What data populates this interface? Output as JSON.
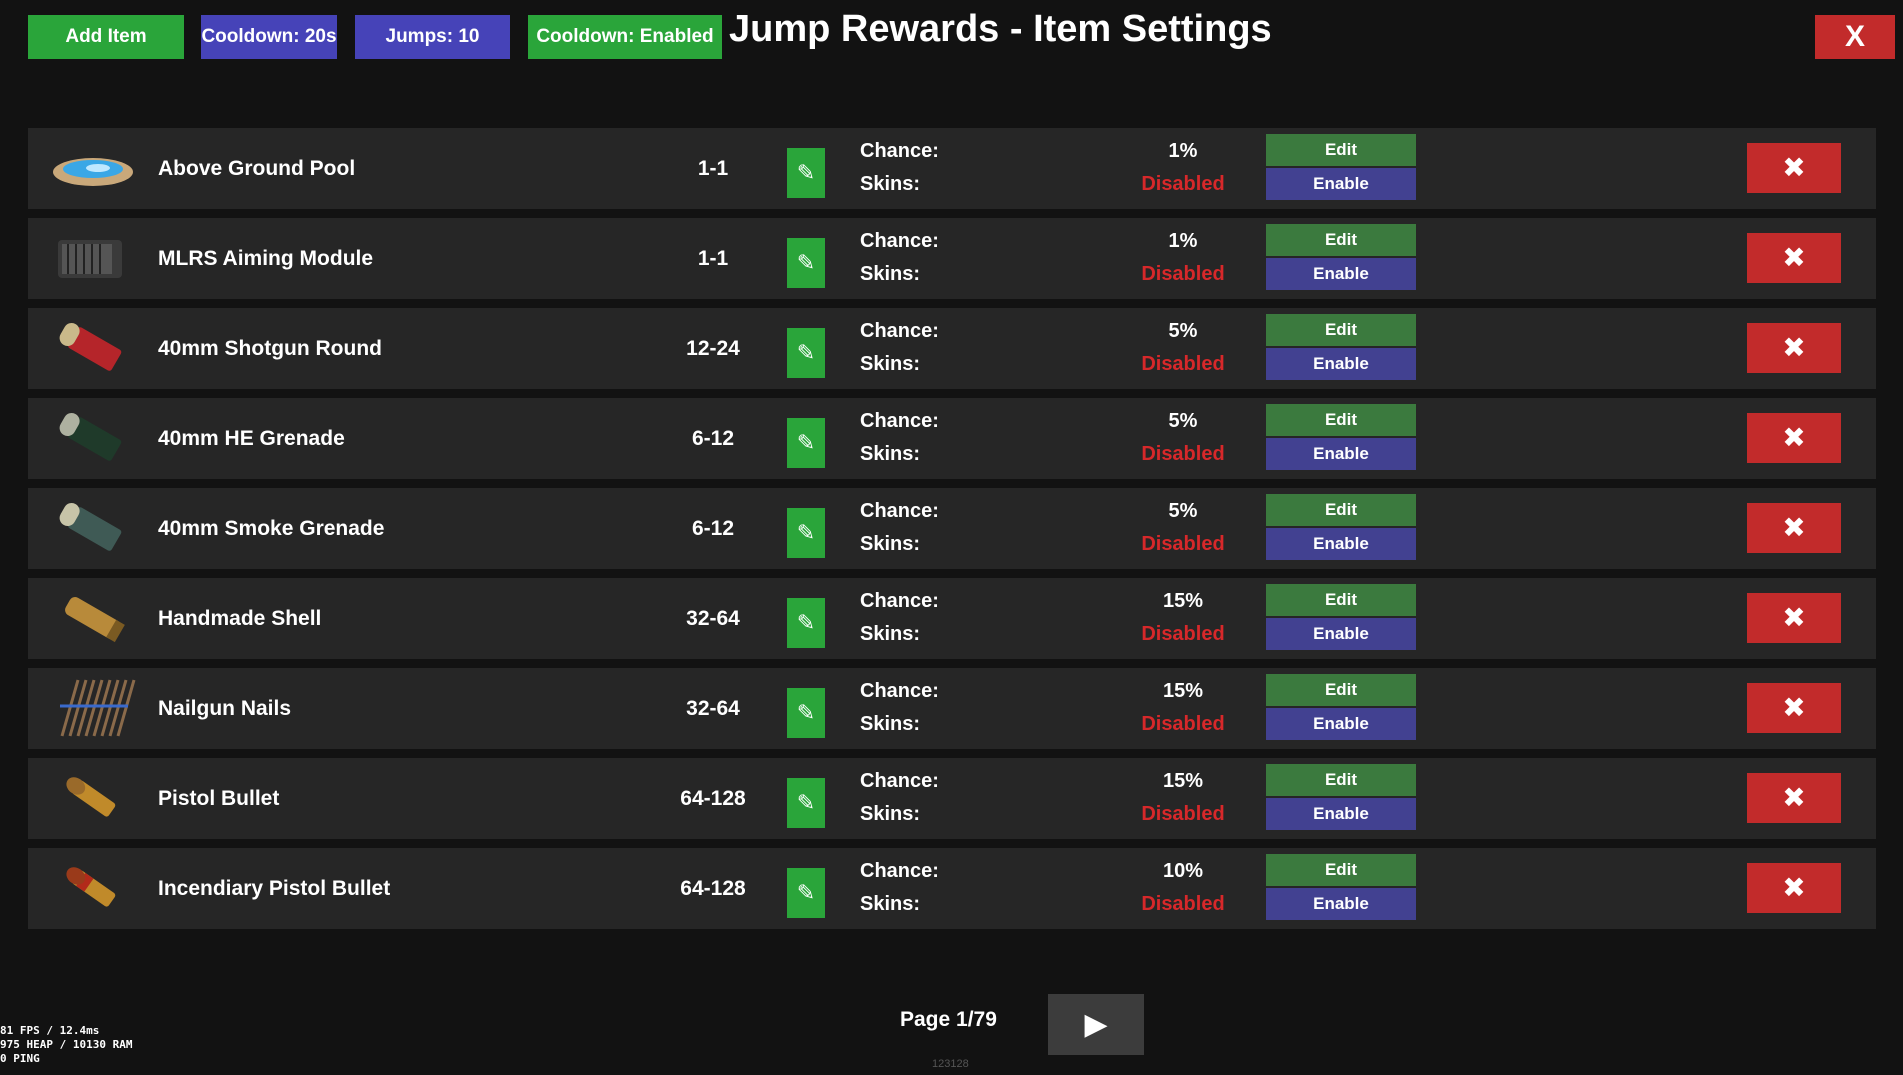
{
  "header": {
    "add_item": "Add Item",
    "cooldown": "Cooldown: 20s",
    "jumps": "Jumps: 10",
    "cooldown_toggle": "Cooldown: Enabled",
    "title": "Jump Rewards - Item Settings",
    "close": "X"
  },
  "labels": {
    "chance": "Chance:",
    "skins": "Skins:",
    "edit": "Edit",
    "enable": "Enable",
    "pencil_glyph": "✎",
    "delete_glyph": "✖"
  },
  "items": [
    {
      "name": "Above Ground Pool",
      "range": "1-1",
      "chance": "1%",
      "skins": "Disabled",
      "icon": "pool-icon"
    },
    {
      "name": "MLRS Aiming Module",
      "range": "1-1",
      "chance": "1%",
      "skins": "Disabled",
      "icon": "aiming-module-icon"
    },
    {
      "name": "40mm Shotgun Round",
      "range": "12-24",
      "chance": "5%",
      "skins": "Disabled",
      "icon": "shotgun-round-icon"
    },
    {
      "name": "40mm HE Grenade",
      "range": "6-12",
      "chance": "5%",
      "skins": "Disabled",
      "icon": "he-grenade-icon"
    },
    {
      "name": "40mm Smoke Grenade",
      "range": "6-12",
      "chance": "5%",
      "skins": "Disabled",
      "icon": "smoke-grenade-icon"
    },
    {
      "name": "Handmade Shell",
      "range": "32-64",
      "chance": "15%",
      "skins": "Disabled",
      "icon": "handmade-shell-icon"
    },
    {
      "name": "Nailgun Nails",
      "range": "32-64",
      "chance": "15%",
      "skins": "Disabled",
      "icon": "nails-icon"
    },
    {
      "name": "Pistol Bullet",
      "range": "64-128",
      "chance": "15%",
      "skins": "Disabled",
      "icon": "pistol-bullet-icon"
    },
    {
      "name": "Incendiary Pistol Bullet",
      "range": "64-128",
      "chance": "10%",
      "skins": "Disabled",
      "icon": "incendiary-bullet-icon"
    }
  ],
  "pagination": {
    "label": "Page 1/79",
    "next_glyph": "▶"
  },
  "hud": {
    "fps": "81 FPS / 12.4ms",
    "mem": "975 HEAP / 10130 RAM",
    "ping": "0 PING"
  },
  "footer_id": "123128",
  "colors": {
    "green": "#2aa53a",
    "blue": "#4643b8",
    "red": "#c22b2b",
    "edit_green": "#3b7a3e",
    "enable_purple": "#424191",
    "disabled_red": "#d7282a"
  }
}
